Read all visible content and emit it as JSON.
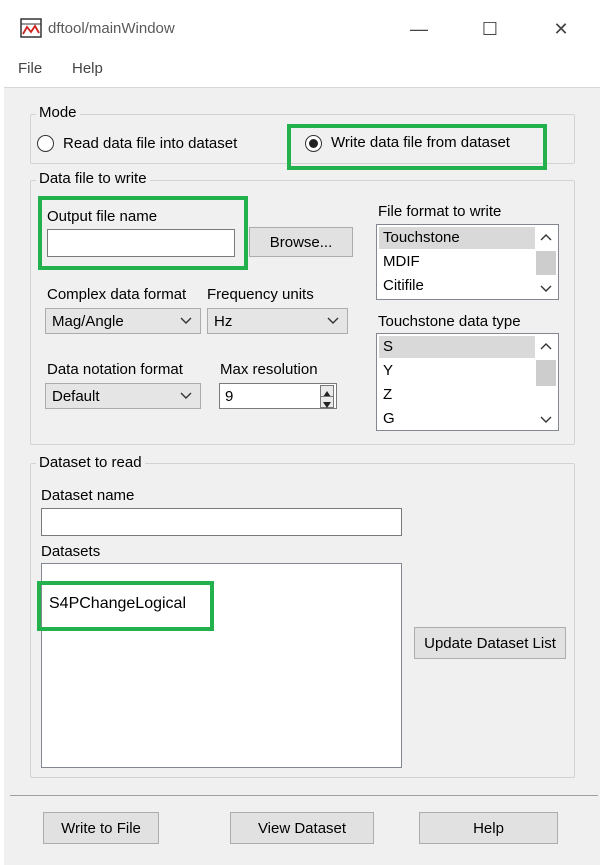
{
  "window": {
    "title": "dftool/mainWindow",
    "controls": {
      "minimize": "—",
      "maximize": "☐",
      "close": "✕"
    }
  },
  "menu": {
    "file": "File",
    "help": "Help"
  },
  "mode": {
    "title": "Mode",
    "read_option": "Read data file into dataset",
    "write_option": "Write data file from dataset",
    "selected": "write"
  },
  "data_file": {
    "title": "Data file to write",
    "output_label": "Output file name",
    "output_value": "",
    "browse_label": "Browse...",
    "complex_label": "Complex data format",
    "complex_value": "Mag/Angle",
    "freq_label": "Frequency units",
    "freq_value": "Hz",
    "notation_label": "Data notation format",
    "notation_value": "Default",
    "maxres_label": "Max resolution",
    "maxres_value": "9",
    "format_label": "File format to write",
    "formats": [
      "Touchstone",
      "MDIF",
      "Citifile"
    ],
    "format_selected": "Touchstone",
    "ts_type_label": "Touchstone data type",
    "ts_types": [
      "S",
      "Y",
      "Z",
      "G"
    ],
    "ts_type_selected": "S"
  },
  "dataset": {
    "title": "Dataset to read",
    "name_label": "Dataset name",
    "name_value": "",
    "list_label": "Datasets",
    "items": [
      "S4PChangeLogical"
    ],
    "update_label": "Update Dataset List"
  },
  "footer": {
    "write_label": "Write to File",
    "view_label": "View Dataset",
    "help_label": "Help"
  },
  "colors": {
    "highlight": "#23b14d",
    "background": "#f0f0f0",
    "selection": "#d9d9d9"
  },
  "icons": {
    "app": "dftool-app-icon",
    "chevron": "chevron-down-icon"
  }
}
